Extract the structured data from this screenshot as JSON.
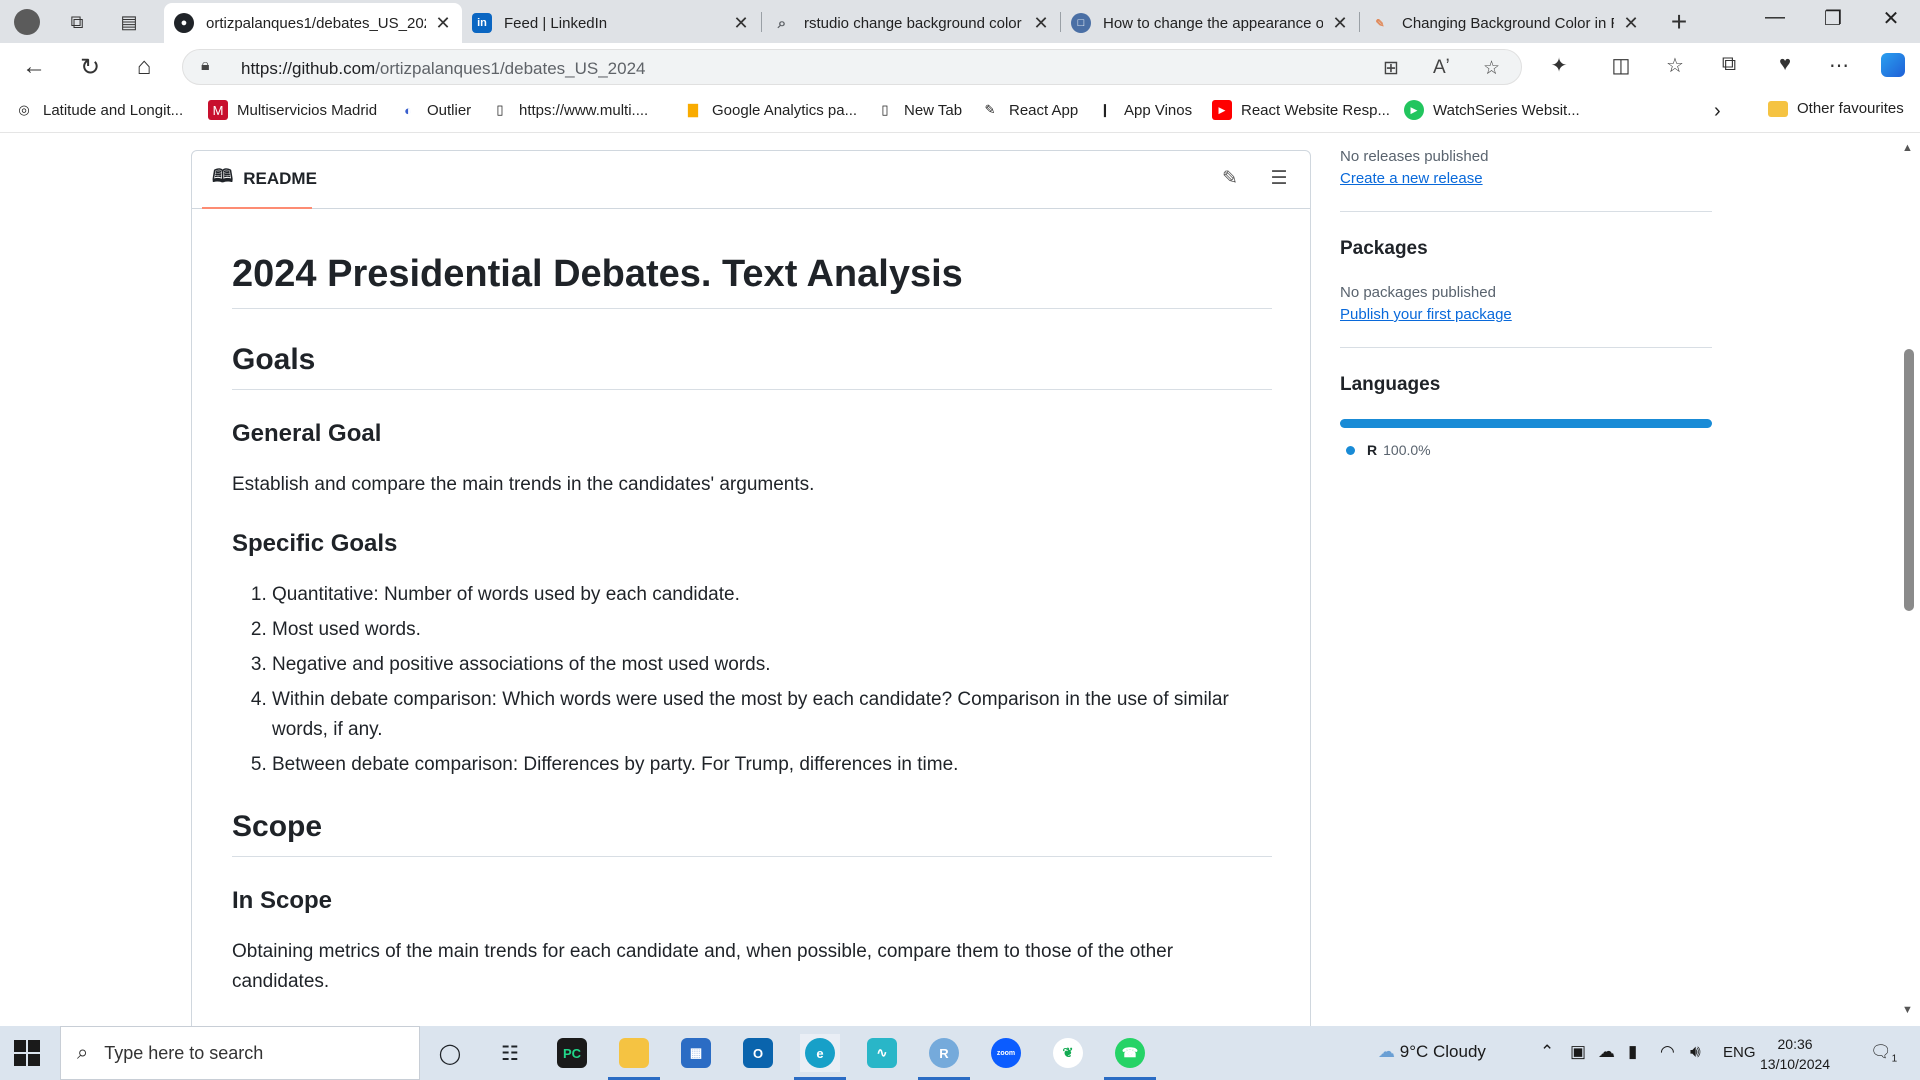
{
  "tabs": [
    {
      "title": "ortizpalanques1/debates_US_2024",
      "icon": "github-icon",
      "active": true
    },
    {
      "title": "Feed | LinkedIn",
      "icon": "linkedin-icon",
      "active": false
    },
    {
      "title": "rstudio change background color",
      "icon": "search-icon",
      "active": false
    },
    {
      "title": "How to change the appearance of",
      "icon": "page-icon",
      "active": false
    },
    {
      "title": "Changing Background Color in R",
      "icon": "page-icon",
      "active": false
    }
  ],
  "address": {
    "url_host": "https://github.com",
    "url_path": "/ortizpalanques1/debates_US_2024"
  },
  "favourites": [
    {
      "label": "Latitude and Longit...",
      "icon": "compass-icon"
    },
    {
      "label": "Multiservicios Madrid",
      "icon": "shop-icon"
    },
    {
      "label": "Outlier",
      "icon": "outlier-icon"
    },
    {
      "label": "https://www.multi....",
      "icon": "page-icon"
    },
    {
      "label": "Google Analytics pa...",
      "icon": "analytics-icon"
    },
    {
      "label": "New Tab",
      "icon": "page-icon"
    },
    {
      "label": "React App",
      "icon": "pen-icon"
    },
    {
      "label": "App Vinos",
      "icon": "bottle-icon"
    },
    {
      "label": "React Website Resp...",
      "icon": "youtube-icon"
    },
    {
      "label": "WatchSeries Websit...",
      "icon": "play-icon"
    }
  ],
  "other_favourites": "Other favourites",
  "readme": {
    "tab_label": "README",
    "title": "2024 Presidential Debates. Text Analysis",
    "h_goals": "Goals",
    "h_general": "General Goal",
    "general_text": "Establish and compare the main trends in the candidates' arguments.",
    "h_specific": "Specific Goals",
    "specific_goals": [
      "Quantitative: Number of words used by each candidate.",
      "Most used words.",
      "Negative and positive associations of the most used words.",
      "Within debate comparison: Which words were used the most by each candidate? Comparison in the use of similar words, if any.",
      "Between debate comparison: Differences by party. For Trump, differences in time."
    ],
    "h_scope": "Scope",
    "h_in_scope": "In Scope",
    "in_scope_text": "Obtaining metrics of the main trends for each candidate and, when possible, compare them to those of the other candidates."
  },
  "sidebar": {
    "releases_text": "No releases published",
    "releases_link": "Create a new release",
    "packages_title": "Packages",
    "packages_text": "No packages published",
    "packages_link": "Publish your first package",
    "languages_title": "Languages",
    "language_name": "R",
    "language_pct": "100.0%",
    "language_color": "#198bd6"
  },
  "taskbar": {
    "search_placeholder": "Type here to search",
    "weather": "9°C  Cloudy",
    "lang": "ENG",
    "time": "20:36",
    "date": "13/10/2024",
    "notifications": "1"
  }
}
